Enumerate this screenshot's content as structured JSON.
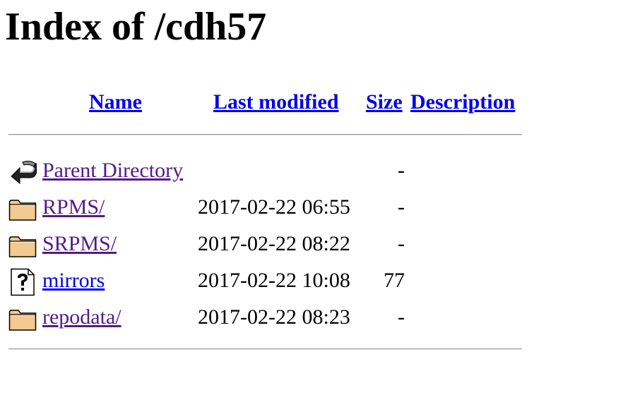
{
  "page_title": "Index of /cdh57",
  "columns": {
    "name": "Name",
    "last_modified": "Last modified",
    "size": "Size",
    "description": "Description"
  },
  "entries": [
    {
      "name": "Parent Directory",
      "last_modified": "",
      "size": "-",
      "description": "",
      "icon": "back-icon",
      "visited": true
    },
    {
      "name": "RPMS/",
      "last_modified": "2017-02-22 06:55",
      "size": "-",
      "description": "",
      "icon": "folder-icon",
      "visited": true
    },
    {
      "name": "SRPMS/",
      "last_modified": "2017-02-22 08:22",
      "size": "-",
      "description": "",
      "icon": "folder-icon",
      "visited": true
    },
    {
      "name": "mirrors",
      "last_modified": "2017-02-22 10:08",
      "size": "77",
      "description": "",
      "icon": "unknown-file-icon",
      "visited": false
    },
    {
      "name": "repodata/",
      "last_modified": "2017-02-22 08:23",
      "size": "-",
      "description": "",
      "icon": "folder-icon",
      "visited": true
    }
  ],
  "colors": {
    "link": "#0000ee",
    "visited_link": "#551a8b",
    "folder_fill": "#f2c98f",
    "rule": "#9a9a9a"
  }
}
